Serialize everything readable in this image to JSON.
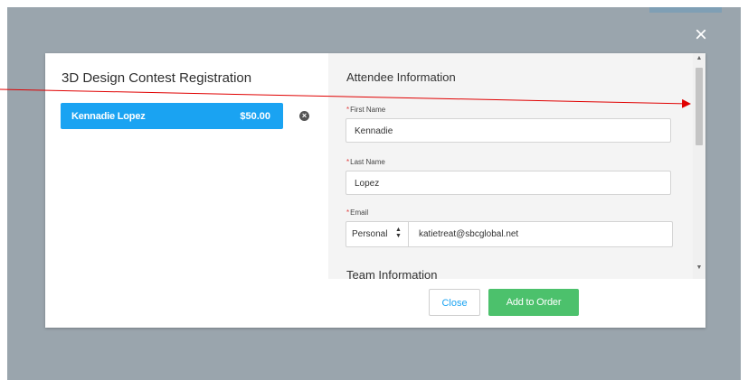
{
  "modal": {
    "title": "3D Design Contest Registration",
    "close_icon": "×",
    "attendee": {
      "name": "Kennadie Lopez",
      "price": "$50.00"
    },
    "remove_icon": "×"
  },
  "attendee_info": {
    "section_title": "Attendee Information",
    "first_name": {
      "label": "First Name",
      "value": "Kennadie"
    },
    "last_name": {
      "label": "Last Name",
      "value": "Lopez"
    },
    "email": {
      "label": "Email",
      "type": "Personal",
      "value": "katietreat@sbcglobal.net"
    },
    "required_marker": "*"
  },
  "team_info": {
    "section_title": "Team Information"
  },
  "footer": {
    "close_label": "Close",
    "add_label": "Add to Order"
  },
  "colors": {
    "accent_blue": "#1aa3f2",
    "add_green": "#4cc16c",
    "annotation_red": "#e00000"
  },
  "icons": [
    "close-icon",
    "remove-icon",
    "select-arrows-icon",
    "scroll-up-icon",
    "scroll-down-icon"
  ]
}
